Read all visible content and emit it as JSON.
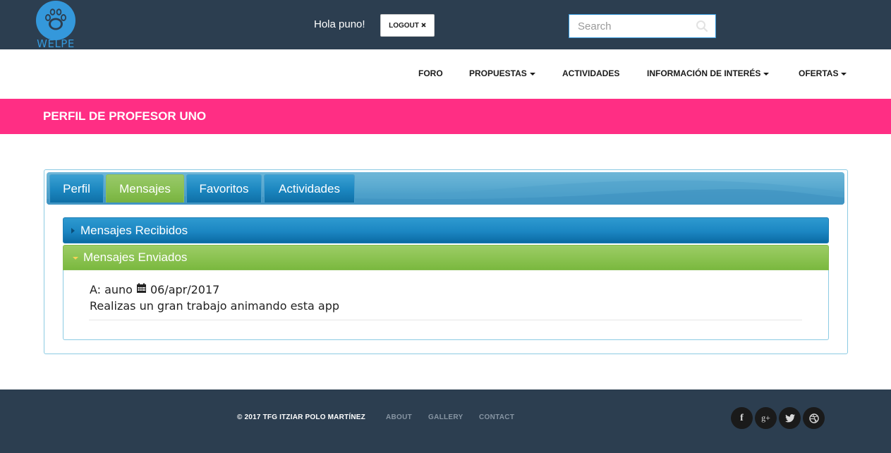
{
  "header": {
    "logo_text": "WELPE",
    "greeting": "Hola puno!",
    "logout_label": "LOGOUT",
    "logout_icon": "close-icon",
    "search": {
      "placeholder": "Search",
      "value": ""
    }
  },
  "nav": {
    "items": [
      {
        "label": "FORO",
        "dropdown": false
      },
      {
        "label": "PROPUESTAS",
        "dropdown": true
      },
      {
        "label": "ACTIVIDADES",
        "dropdown": false
      },
      {
        "label": "INFORMACIÓN DE INTERÉS",
        "dropdown": true
      },
      {
        "label": "OFERTAS",
        "dropdown": true
      }
    ]
  },
  "banner": {
    "title": "PERFIL DE PROFESOR UNO"
  },
  "tabs": {
    "items": [
      {
        "label": "Perfil",
        "active": false
      },
      {
        "label": "Mensajes",
        "active": true
      },
      {
        "label": "Favoritos",
        "active": false
      },
      {
        "label": "Actividades",
        "active": false
      }
    ]
  },
  "accordion": {
    "received": {
      "label": "Mensajes Recibidos",
      "expanded": false
    },
    "sent": {
      "label": "Mensajes Enviados",
      "expanded": true,
      "messages": [
        {
          "to_prefix": "A:",
          "recipient": "auno",
          "date_icon": "calendar-icon",
          "date": "06/apr/2017",
          "text": "Realizas un gran trabajo animando esta app"
        }
      ]
    }
  },
  "footer": {
    "copyright": "© 2017 TFG ITZIAR POLO MARTÍNEZ",
    "links": [
      "ABOUT",
      "GALLERY",
      "CONTACT"
    ],
    "social": [
      {
        "icon": "facebook-icon",
        "glyph": "f"
      },
      {
        "icon": "google-plus-icon",
        "glyph": "g+"
      },
      {
        "icon": "twitter-icon",
        "glyph": "t"
      },
      {
        "icon": "dribbble-icon",
        "glyph": "d"
      }
    ]
  },
  "colors": {
    "topbar": "#2c3e50",
    "accent_blue": "#3498db",
    "banner_pink": "#ff2e84",
    "tab_active_green": "#86be50",
    "tab_blue": "#1b86bf"
  }
}
